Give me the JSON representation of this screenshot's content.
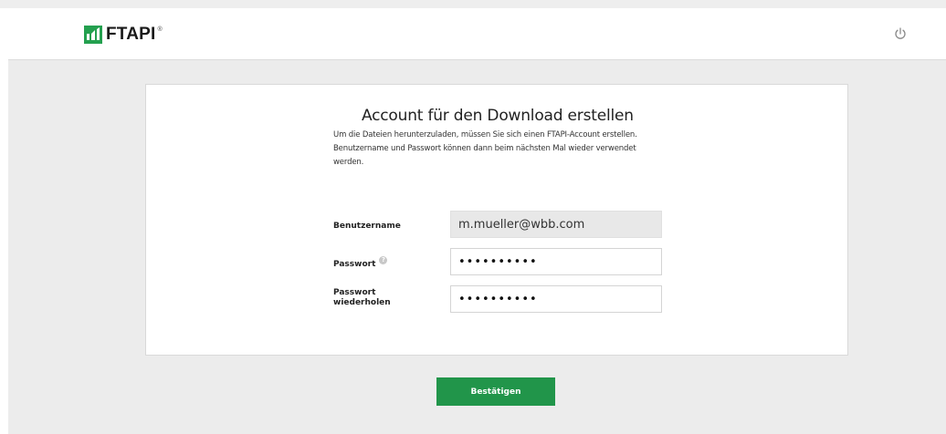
{
  "header": {
    "logo_text": "FTAPI",
    "logo_reg": "®",
    "logo_icon": "ftapi-logo-icon",
    "power_icon": "power-icon"
  },
  "form": {
    "title": "Account für den Download erstellen",
    "description": "Um die Dateien herunterzuladen, müssen Sie sich einen FTAPI-Account erstellen. Benutzername und Passwort können dann beim nächsten Mal wieder verwendet werden.",
    "username": {
      "label": "Benutzername",
      "value": "m.mueller@wbb.com"
    },
    "password": {
      "label": "Passwort",
      "help_icon": "help-icon",
      "value": "••••••••••"
    },
    "password_repeat": {
      "label_line1": "Passwort",
      "label_line2": "wiederholen",
      "value": "••••••••••"
    }
  },
  "actions": {
    "confirm_label": "Bestätigen"
  },
  "colors": {
    "accent": "#21954a",
    "background": "#ececec"
  }
}
